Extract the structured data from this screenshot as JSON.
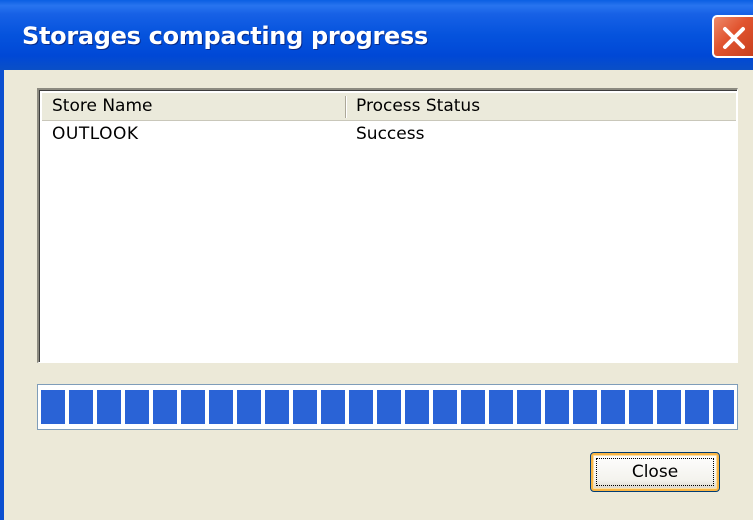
{
  "window": {
    "title": "Storages compacting progress",
    "close_icon": "close-icon"
  },
  "listview": {
    "columns": [
      "Store Name",
      "Process Status"
    ],
    "rows": [
      {
        "store_name": "OUTLOOK",
        "status": "Success"
      }
    ]
  },
  "progress": {
    "value": 1.0,
    "color": "#2a63d6"
  },
  "buttons": {
    "close_label": "Close"
  },
  "colors": {
    "titlebar": "#0553dd",
    "close_icon_bg": "#e1542f",
    "dialog_bg": "#ece9d8",
    "button_focus": "#f9b545"
  }
}
